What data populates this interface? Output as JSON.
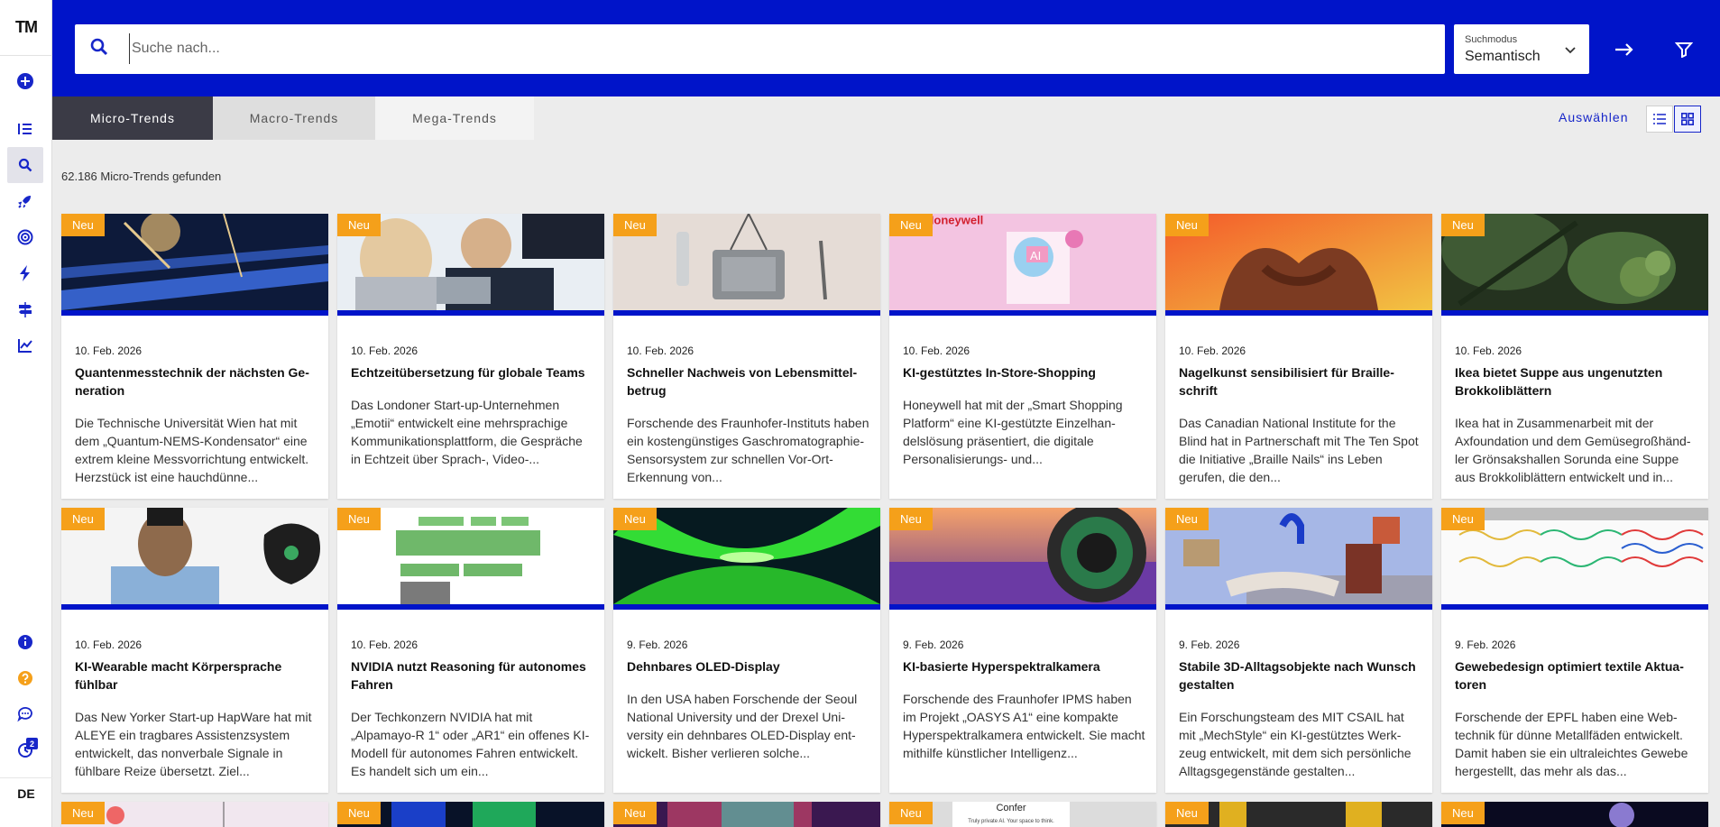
{
  "sidebar": {
    "logo": "TM",
    "badge_count": "2",
    "language": "DE",
    "icons": [
      "add-icon",
      "list-icon",
      "search-icon",
      "rocket-icon",
      "target-icon",
      "bolt-icon",
      "signpost-icon",
      "chart-icon",
      "info-icon",
      "help-icon",
      "chat-icon",
      "history-icon"
    ],
    "colors": {
      "info": "#1726c9",
      "help": "#f5a01a",
      "brand": "#0014c9"
    }
  },
  "search": {
    "placeholder": "Suche nach...",
    "mode_label": "Suchmodus",
    "mode_value": "Semantisch"
  },
  "tabs": [
    "Micro-Trends",
    "Macro-Trends",
    "Mega-Trends"
  ],
  "toolbar": {
    "select_label": "Auswählen"
  },
  "results": {
    "count_text": "62.186 Micro-Trends gefunden"
  },
  "badge_label": "Neu",
  "cards": [
    {
      "date": "10. Feb. 2026",
      "title": "Quantenmesstechnik der nächsten Ge­neration",
      "desc": "Die Technische Universität Wien hat mit dem „Quantum-NEMS-Kondensator“ eine extrem kleine Messvorrichtung entwi­ckelt. Herzstück ist eine hauchdünne...",
      "lines": 2
    },
    {
      "date": "10. Feb. 2026",
      "title": "Echtzeitübersetzung für globale Teams",
      "desc": "Das Londoner Start-up-Unternehmen „Emotii“ entwickelt eine mehrsprachige Kommunikationsplattform, die Gespräche in Echtzeit über Sprach-, Video-...",
      "lines": 1
    },
    {
      "date": "10. Feb. 2026",
      "title": "Schneller Nachweis von Lebensmittel­betrug",
      "desc": "Forschende des Fraunhofer-Instituts ha­ben ein kostengünstiges Gaschromatographie-Sensorsystem zur schnellen Vor-Ort-Erkennung von...",
      "lines": 2
    },
    {
      "date": "10. Feb. 2026",
      "title": "KI-gestütztes In-Store-Shopping",
      "desc": "Honeywell hat mit der „Smart Shopping Platform“ eine KI-gestützte Einzelhan­delslösung präsentiert, die digitale Personalisierungs- und...",
      "lines": 1
    },
    {
      "date": "10. Feb. 2026",
      "title": "Nagelkunst sensibilisiert für Braille­schrift",
      "desc": "Das Canadian National Institute for the Blind hat in Partnerschaft mit The Ten Spot die Initiative „Braille Nails“ ins Le­ben gerufen, die den...",
      "lines": 2
    },
    {
      "date": "10. Feb. 2026",
      "title": "Ikea bietet Suppe aus ungenutzten Brokkoliblättern",
      "desc": "Ikea hat in Zusammenarbeit mit der Axfoundation und dem Gemüsegroßhänd­ler Grönsakshallen Sorunda eine Suppe aus Brokkoliblättern entwickelt und in...",
      "lines": 2
    },
    {
      "date": "10. Feb. 2026",
      "title": "KI-Wearable macht Körpersprache fühlbar",
      "desc": "Das New Yorker Start-up HapWare hat mit ALEYE ein tragbares Assistenzsystem entwickelt, das nonverbale Signale in fühlbare Reize übersetzt. Ziel...",
      "lines": 2
    },
    {
      "date": "10. Feb. 2026",
      "title": "NVIDIA nutzt Reasoning für autonomes Fahren",
      "desc": "Der Techkonzern NVIDIA hat mit „Alpamayo-R 1“ oder „AR1“ ein offenes KI-Modell für autonomes Fahren entwi­ckelt. Es handelt sich um ein...",
      "lines": 2
    },
    {
      "date": "9. Feb. 2026",
      "title": "Dehnbares OLED-Display",
      "desc": "In den USA haben Forschende der Seoul National University und der Drexel Uni­versity ein dehnbares OLED-Display ent­wickelt. Bisher verlieren solche...",
      "lines": 1
    },
    {
      "date": "9. Feb. 2026",
      "title": "KI-basierte Hyperspektralkamera",
      "desc": "Forschende des Fraunhofer IPMS haben im Projekt „OASYS A1“ eine kompakte Hyperspektralkamera entwickelt. Sie macht mithilfe künstlicher Intelligenz...",
      "lines": 1
    },
    {
      "date": "9. Feb. 2026",
      "title": "Stabile 3D-Alltagsobjekte nach Wunsch gestalten",
      "desc": "Ein Forschungsteam des MIT CSAIL hat mit „MechStyle“ ein KI-gestütztes Werk­zeug entwickelt, mit dem sich persönli­che Alltagsgegenstände gestalten...",
      "lines": 2
    },
    {
      "date": "9. Feb. 2026",
      "title": "Gewebedesign optimiert textile Aktua­toren",
      "desc": "Forschende der EPFL haben eine Web­technik für dünne Metallfäden entwickelt. Damit haben sie ein ultraleichtes Gewebe hergestellt, das mehr als das...",
      "lines": 2
    }
  ],
  "image_texts": {
    "honeywell": "Honeywell",
    "ai": "AI",
    "confer": "Confer",
    "confer_sub": "Truly private AI. Your space to think."
  }
}
